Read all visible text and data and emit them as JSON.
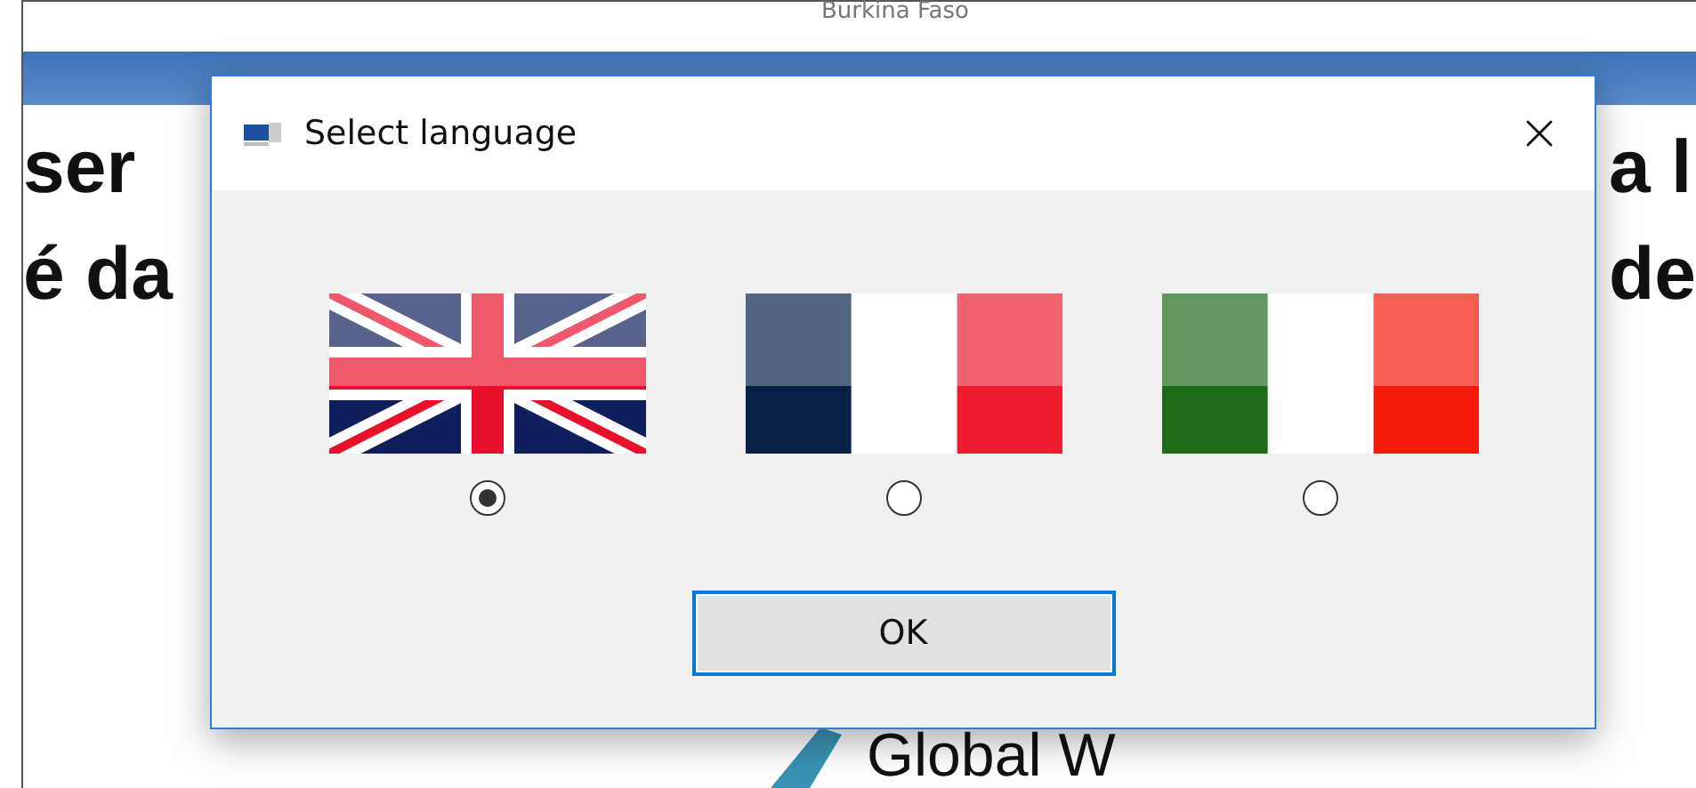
{
  "background": {
    "title": "Burkina Faso",
    "left_lines": [
      "ser",
      "é da"
    ],
    "right_lines": [
      "a l",
      "de"
    ],
    "footer": "Global W"
  },
  "dialog": {
    "title": "Select language",
    "languages": [
      {
        "kind": "uk",
        "selected": true
      },
      {
        "kind": "france",
        "selected": false
      },
      {
        "kind": "italy",
        "selected": false
      }
    ],
    "button": "OK"
  }
}
